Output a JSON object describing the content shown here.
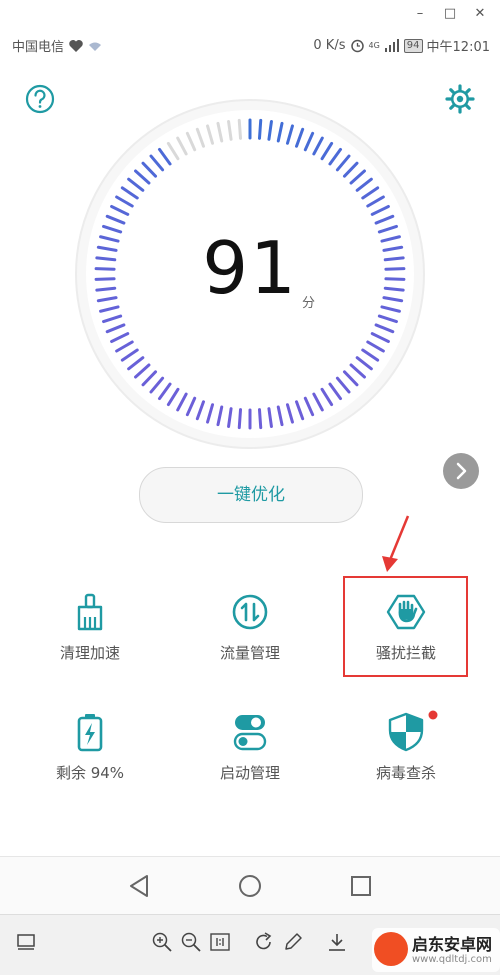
{
  "window_controls": {
    "minimize": "–",
    "maximize": "□",
    "close": "✕"
  },
  "status_bar": {
    "carrier": "中国电信",
    "speed": "0 K/s",
    "signal": "4G",
    "battery": "94",
    "time": "中午12:01"
  },
  "colors": {
    "teal": "#1f9aa3",
    "gauge_blue": "#3d6fd6",
    "gauge_purple": "#6d5fd8",
    "gauge_inactive": "#d9d9d9",
    "highlight": "#e53935",
    "badge": "#e53935"
  },
  "header": {
    "help_icon": "help-circle-icon",
    "settings_icon": "gear-icon"
  },
  "score": {
    "value": "91",
    "unit": "分",
    "fraction": 0.91
  },
  "optimize_button": {
    "label": "一键优化"
  },
  "tiles": [
    {
      "label": "清理加速",
      "icon": "broom-icon"
    },
    {
      "label": "流量管理",
      "icon": "data-traffic-icon"
    },
    {
      "label": "骚扰拦截",
      "icon": "hand-block-icon"
    },
    {
      "label": "剩余 94%",
      "icon": "battery-icon"
    },
    {
      "label": "启动管理",
      "icon": "toggle-icon"
    },
    {
      "label": "病毒查杀",
      "icon": "shield-icon"
    }
  ],
  "watermark": {
    "title": "启东安卓网",
    "url": "www.qdltdj.com"
  }
}
